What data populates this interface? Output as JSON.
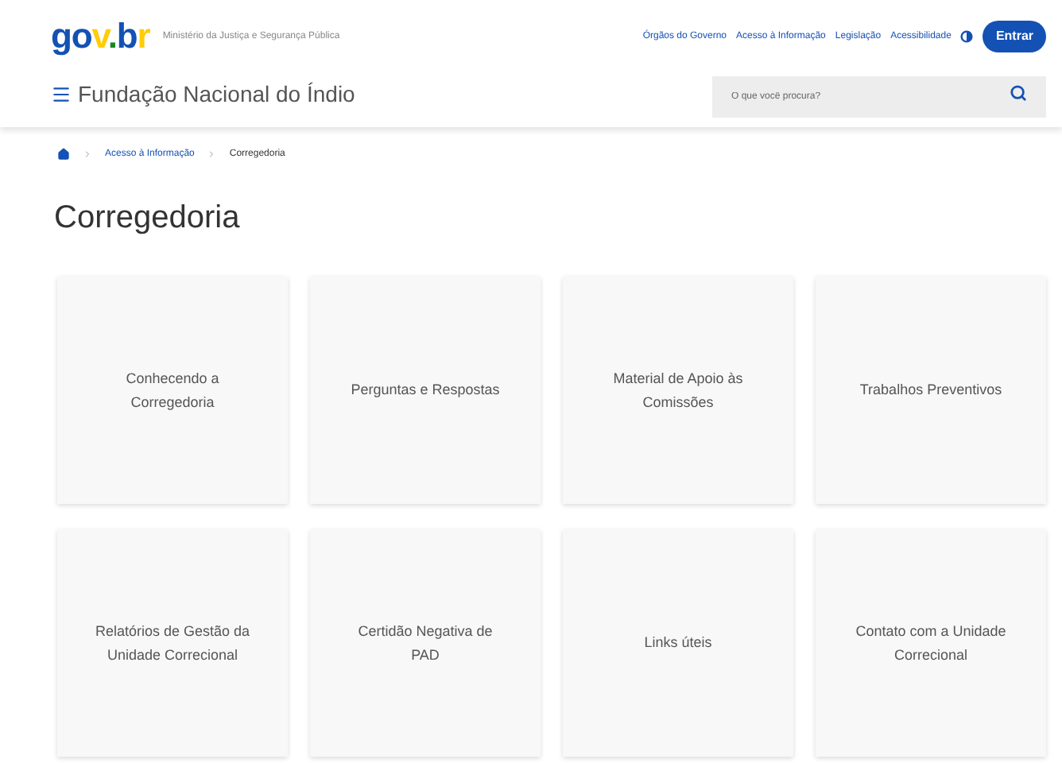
{
  "header": {
    "logo": "gov.br",
    "ministry": "Ministério da Justiça e Segurança Pública",
    "links": [
      "Órgãos do Governo",
      "Acesso à Informação",
      "Legislação",
      "Acessibilidade"
    ],
    "login_button": "Entrar"
  },
  "site": {
    "title": "Fundação Nacional do Índio",
    "search": {
      "placeholder": "O que você procura?"
    }
  },
  "breadcrumb": [
    "Acesso à Informação",
    "Corregedoria"
  ],
  "page_title": "Corregedoria",
  "cards": [
    "Conhecendo a Corregedoria",
    "Perguntas e Respostas",
    "Material de Apoio às Comissões",
    "Trabalhos Preventivos",
    "Relatórios de Gestão da Unidade Correcional",
    "Certidão Negativa de PAD",
    "Links úteis",
    "Contato com a Unidade Correcional"
  ]
}
